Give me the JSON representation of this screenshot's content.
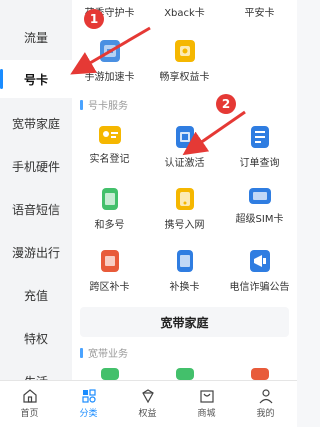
{
  "sidebar": {
    "items": [
      {
        "label": "流量"
      },
      {
        "label": "号卡"
      },
      {
        "label": "宽带家庭"
      },
      {
        "label": "手机硬件"
      },
      {
        "label": "语音短信"
      },
      {
        "label": "漫游出行"
      },
      {
        "label": "充值"
      },
      {
        "label": "特权"
      },
      {
        "label": "生活"
      }
    ],
    "active_index": 1
  },
  "top_row": [
    {
      "label": "花季守护卡"
    },
    {
      "label": "Xback卡"
    },
    {
      "label": "平安卡"
    }
  ],
  "row2": [
    {
      "label": "手游加速卡",
      "icon": "game-card-icon"
    },
    {
      "label": "畅享权益卡",
      "icon": "benefit-card-icon"
    }
  ],
  "section_card": {
    "title": "号卡服务",
    "items": [
      {
        "label": "实名登记",
        "icon": "id-card-icon"
      },
      {
        "label": "认证激活",
        "icon": "sim-activate-icon"
      },
      {
        "label": "订单查询",
        "icon": "order-query-icon"
      },
      {
        "label": "和多号",
        "icon": "multi-number-icon"
      },
      {
        "label": "携号入网",
        "icon": "transfer-number-icon"
      },
      {
        "label": "超级SIM卡",
        "icon": "super-sim-icon"
      },
      {
        "label": "跨区补卡",
        "icon": "cross-region-card-icon"
      },
      {
        "label": "补换卡",
        "icon": "replace-card-icon"
      },
      {
        "label": "电信诈骗公告",
        "icon": "fraud-notice-icon"
      }
    ]
  },
  "banner": {
    "title": "宽带家庭"
  },
  "section_broadband": {
    "title": "宽带业务"
  },
  "tabs": [
    {
      "label": "首页",
      "icon": "home-icon"
    },
    {
      "label": "分类",
      "icon": "category-icon"
    },
    {
      "label": "权益",
      "icon": "benefits-icon"
    },
    {
      "label": "商城",
      "icon": "mall-icon"
    },
    {
      "label": "我的",
      "icon": "profile-icon"
    }
  ],
  "active_tab": 1,
  "annotations": [
    {
      "label": "1"
    },
    {
      "label": "2"
    }
  ],
  "colors": {
    "accent": "#1a8cff",
    "annotation": "#e53935"
  }
}
